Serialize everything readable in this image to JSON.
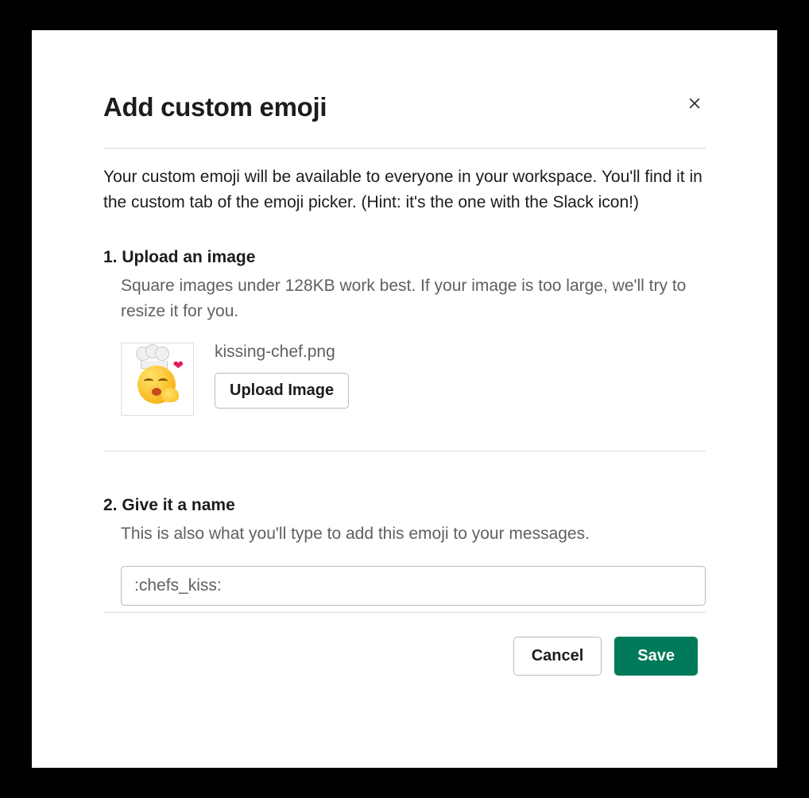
{
  "modal": {
    "title": "Add custom emoji",
    "description": "Your custom emoji will be available to everyone in your workspace. You'll find it in the custom tab of the emoji picker. (Hint: it's the one with the Slack icon!)"
  },
  "step1": {
    "heading": "1. Upload an image",
    "subtext": "Square images under 128KB work best. If your image is too large, we'll try to resize it for you.",
    "filename": "kissing-chef.png",
    "upload_button_label": "Upload Image"
  },
  "step2": {
    "heading": "2. Give it a name",
    "subtext": "This is also what you'll type to add this emoji to your messages.",
    "input_value": ":chefs_kiss:"
  },
  "footer": {
    "cancel_label": "Cancel",
    "save_label": "Save"
  }
}
